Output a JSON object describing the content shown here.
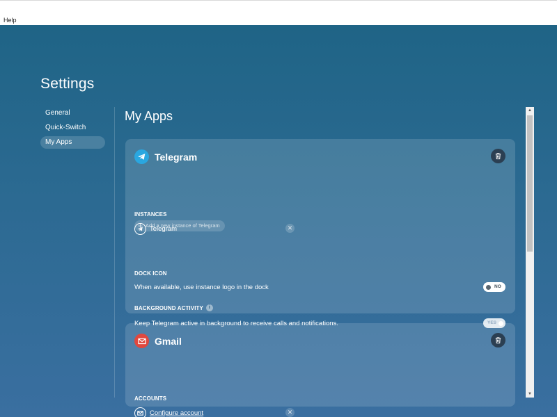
{
  "menubar": {
    "help": "Help"
  },
  "settings": {
    "title": "Settings"
  },
  "nav": {
    "items": [
      {
        "label": "General",
        "active": false
      },
      {
        "label": "Quick-Switch",
        "active": false
      },
      {
        "label": "My Apps",
        "active": true
      }
    ]
  },
  "main": {
    "title": "My Apps",
    "apps": [
      {
        "name": "Telegram",
        "icon": "telegram-icon",
        "icon_color": "#2aa7e0",
        "instances_label": "INSTANCES",
        "instances": [
          {
            "name": "Telegram"
          }
        ],
        "add_instance_label": "Add a new instance of Telegram",
        "dock_icon_label": "DOCK ICON",
        "dock_icon_desc": "When available, use instance logo in the dock",
        "dock_icon_toggle": "NO",
        "background_label": "BACKGROUND ACTIVITY",
        "background_desc": "Keep Telegram active in background to receive calls and notifications.",
        "background_toggle": "YES"
      },
      {
        "name": "Gmail",
        "icon": "gmail-icon",
        "icon_color": "#e0483e",
        "accounts_label": "ACCOUNTS",
        "accounts": [
          {
            "name": "Configure account"
          }
        ]
      }
    ]
  },
  "colors": {
    "background_top": "#1f6486",
    "background_bottom": "#3a6fa0",
    "delete_button": "#2b3f52"
  }
}
